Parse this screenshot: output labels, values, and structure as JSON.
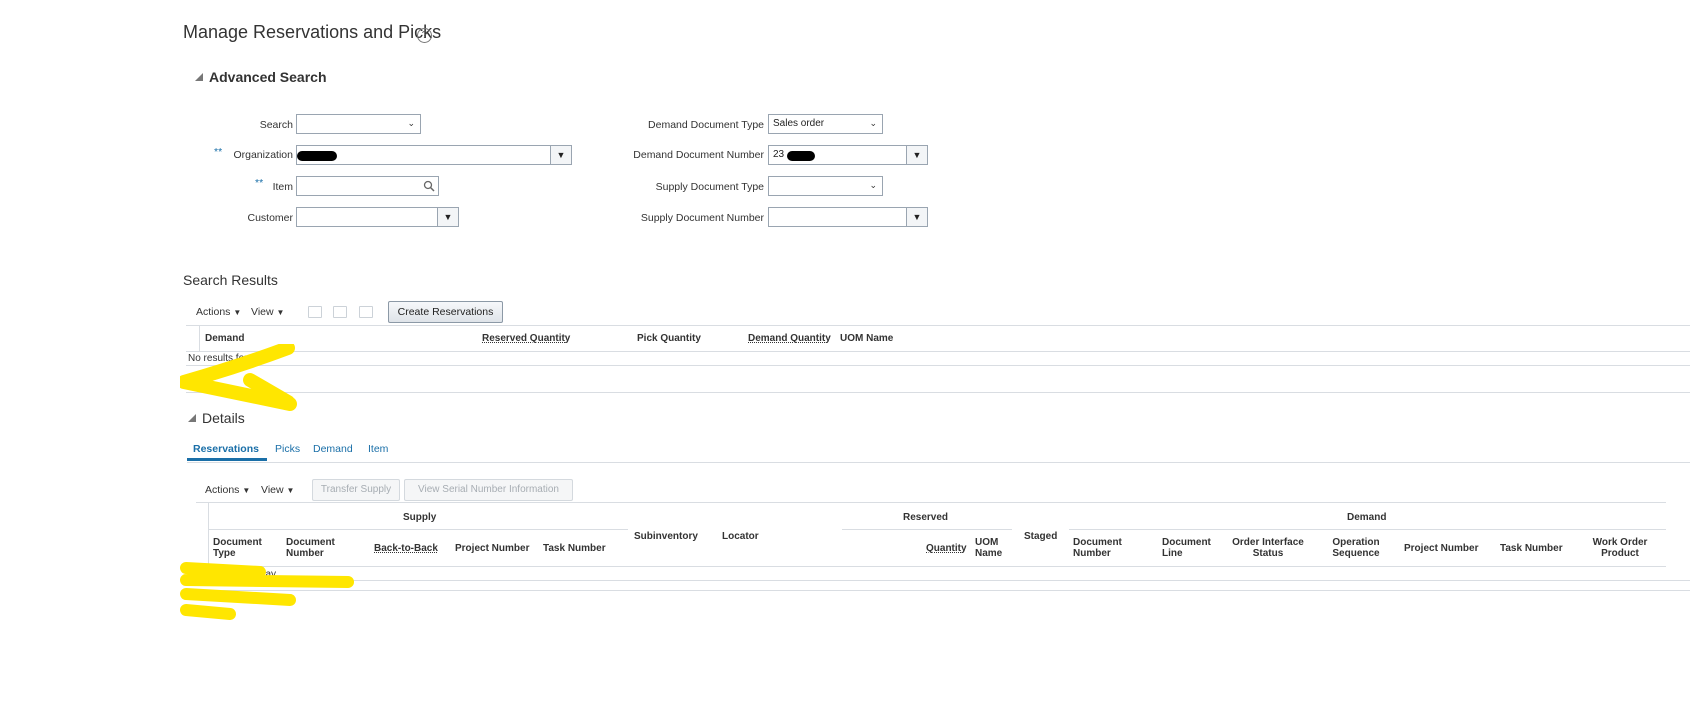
{
  "page": {
    "title": "Manage Reservations and Picks",
    "help_icon": "?"
  },
  "advanced_search": {
    "title": "Advanced Search",
    "required_marker": "**",
    "fields": {
      "search": {
        "label": "Search",
        "value": ""
      },
      "organization": {
        "label": "Organization",
        "value": ""
      },
      "item": {
        "label": "Item",
        "value": ""
      },
      "customer": {
        "label": "Customer",
        "value": ""
      },
      "demand_document_type": {
        "label": "Demand Document Type",
        "value": "Sales order"
      },
      "demand_document_number": {
        "label": "Demand Document Number",
        "value": "23"
      },
      "supply_document_type": {
        "label": "Supply Document Type",
        "value": ""
      },
      "supply_document_number": {
        "label": "Supply Document Number",
        "value": ""
      }
    }
  },
  "search_results": {
    "title": "Search Results",
    "toolbar": {
      "actions": "Actions",
      "view": "View",
      "create_button": "Create Reservations"
    },
    "columns": [
      "Demand",
      "Reserved Quantity",
      "Pick Quantity",
      "Demand Quantity",
      "UOM Name"
    ],
    "empty_text": "No results found."
  },
  "details": {
    "title": "Details",
    "tabs": [
      "Reservations",
      "Picks",
      "Demand",
      "Item"
    ],
    "toolbar": {
      "actions": "Actions",
      "view": "View",
      "transfer_button": "Transfer Supply",
      "serial_button": "View Serial Number Information"
    },
    "groups": {
      "supply": "Supply",
      "reserved": "Reserved",
      "demand": "Demand"
    },
    "columns": {
      "supply_doc_type": "Document Type",
      "supply_doc_number": "Document Number",
      "back_to_back": "Back-to-Back",
      "supply_project": "Project Number",
      "supply_task": "Task Number",
      "subinventory": "Subinventory",
      "locator": "Locator",
      "quantity": "Quantity",
      "uom_name": "UOM Name",
      "staged": "Staged",
      "demand_doc_number": "Document Number",
      "demand_doc_line": "Document Line",
      "order_interface_status": "Order Interface Status",
      "operation_sequence": "Operation Sequence",
      "demand_project": "Project Number",
      "demand_task": "Task Number",
      "work_order_product": "Work Order Product"
    },
    "empty_text": "No data to display."
  },
  "colors": {
    "link": "#1a6fa8",
    "annotation": "#ffe600"
  }
}
